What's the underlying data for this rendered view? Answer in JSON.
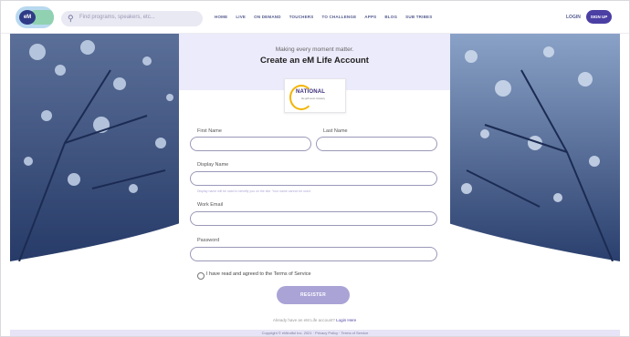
{
  "header": {
    "search_placeholder": "Find programs, speakers, etc...",
    "nav": [
      "HOME",
      "LIVE",
      "ON DEMAND",
      "TOUCHERS",
      "TO CHALLENGE",
      "APPS",
      "BLOG",
      "SUB TRIBES"
    ],
    "login_label": "LOGIN",
    "signup_label": "SIGN UP",
    "logo_text": "eM"
  },
  "card": {
    "tagline": "Making every moment matter.",
    "title": "Create an eM Life Account",
    "org_logo_text": "NATIONAL",
    "org_logo_sub": "the golf event company"
  },
  "form": {
    "first_name_label": "First Name",
    "last_name_label": "Last Name",
    "display_name_label": "Display Name",
    "display_name_hint": "Display name will be used to identify you on the site. Your name cannot be used.",
    "work_email_label": "Work Email",
    "password_label": "Password",
    "terms_label": "I have read and agreed to the Terms of Service",
    "register_label": "REGISTER",
    "already_prefix": "Already have an eM Life account?",
    "login_link": "Login Here"
  },
  "footer": {
    "text": "Copyright © eMindful Inc. 2021 · Privacy Policy · Terms of Service"
  },
  "colors": {
    "accent": "#4b3fa4",
    "header_band": "#ecebfb",
    "tree_sky": "#b8cde4",
    "tree_dark": "#1e2f5c"
  }
}
